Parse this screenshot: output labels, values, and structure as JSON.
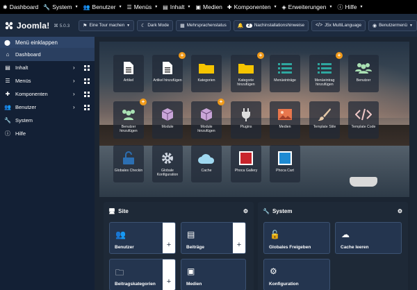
{
  "topmenu": {
    "items": [
      {
        "label": "Dashboard",
        "icon": "joomla-icon"
      },
      {
        "label": "System",
        "icon": "wrench-icon"
      },
      {
        "label": "Benutzer",
        "icon": "users-icon"
      },
      {
        "label": "Menüs",
        "icon": "list-icon"
      },
      {
        "label": "Inhalt",
        "icon": "file-icon"
      },
      {
        "label": "Medien",
        "icon": "image-icon"
      },
      {
        "label": "Komponenten",
        "icon": "puzzle-icon"
      },
      {
        "label": "Erweiterungen",
        "icon": "cube-icon"
      },
      {
        "label": "Hilfe",
        "icon": "info-icon"
      }
    ]
  },
  "header": {
    "brand": "Joomla!",
    "version": "⌘ 5.0.3",
    "buttons": [
      {
        "label": "Eine Tour machen",
        "icon": "signs-icon"
      },
      {
        "label": "Dark Mode",
        "icon": "moon-icon"
      },
      {
        "label": "Mehrsprachenstatus",
        "icon": "language-icon"
      },
      {
        "label": "Nachinstallationshinweise",
        "icon": "bell-icon",
        "badge": "2"
      },
      {
        "label": "J5x MultiLanguage",
        "icon": "code-icon"
      },
      {
        "label": "Benutzermenü",
        "icon": "user-icon"
      }
    ]
  },
  "sidebar": {
    "toggle_label": "Menü einklappen",
    "items": [
      {
        "label": "Dashboard",
        "icon": "home-icon"
      },
      {
        "label": "Inhalt",
        "icon": "file-icon"
      },
      {
        "label": "Menüs",
        "icon": "list-icon"
      },
      {
        "label": "Komponenten",
        "icon": "puzzle-icon"
      },
      {
        "label": "Benutzer",
        "icon": "users-icon"
      },
      {
        "label": "System",
        "icon": "wrench-icon"
      },
      {
        "label": "Hilfe",
        "icon": "info-icon"
      }
    ]
  },
  "hero": {
    "tiles": [
      {
        "label": "Artikel",
        "icon": "article-icon",
        "add": false
      },
      {
        "label": "Artikel hinzufügen",
        "icon": "article-icon",
        "add": true
      },
      {
        "label": "Kategorien",
        "icon": "folder-icon",
        "add": false
      },
      {
        "label": "Kategorie hinzufügen",
        "icon": "folder-icon",
        "add": true
      },
      {
        "label": "Menüeinträge",
        "icon": "menu-list-icon",
        "add": false
      },
      {
        "label": "Menüeintrag hinzufügen",
        "icon": "menu-list-icon",
        "add": true
      },
      {
        "label": "Benutzer",
        "icon": "users-icon",
        "add": false
      },
      {
        "label": "Benutzer hinzufügen",
        "icon": "users-icon",
        "add": true
      },
      {
        "label": "Module",
        "icon": "module-cube-icon",
        "add": false
      },
      {
        "label": "Module hinzufügen",
        "icon": "module-cube-icon",
        "add": true
      },
      {
        "label": "Plugins",
        "icon": "plug-icon",
        "add": false
      },
      {
        "label": "Medien",
        "icon": "image-icon",
        "add": false
      },
      {
        "label": "Template Stile",
        "icon": "brush-icon",
        "add": false
      },
      {
        "label": "Template Code",
        "icon": "code-icon",
        "add": false
      },
      {
        "label": "Globales Checkin",
        "icon": "unlock-icon",
        "add": false
      },
      {
        "label": "Globale Konfiguration",
        "icon": "gear-icon",
        "add": false
      },
      {
        "label": "Cache",
        "icon": "cloud-icon",
        "add": false
      },
      {
        "label": "Phoca Gallery",
        "icon": "pg-logo-icon",
        "add": false
      },
      {
        "label": "Phoca Cart",
        "icon": "pc-logo-icon",
        "add": false
      }
    ]
  },
  "panels": {
    "site": {
      "title": "Site",
      "cards": [
        {
          "label": "Benutzer",
          "icon": "users-icon",
          "add": true
        },
        {
          "label": "Beiträge",
          "icon": "file-icon",
          "add": true
        },
        {
          "label": "Beitragskategorien",
          "icon": "folder-open-icon",
          "add": true
        },
        {
          "label": "Medien",
          "icon": "image-icon",
          "add": false
        }
      ]
    },
    "system": {
      "title": "System",
      "cards": [
        {
          "label": "Globales Freigeben",
          "icon": "unlock-icon",
          "add": false
        },
        {
          "label": "Cache leeren",
          "icon": "cloud-icon",
          "add": false
        },
        {
          "label": "Konfiguration",
          "icon": "gear-icon",
          "add": false
        }
      ]
    }
  },
  "colors": {
    "topbar": "#000000",
    "header": "#1c2a3e",
    "sidebar": "#132035",
    "accent_orange": "#f09a1a",
    "folder_yellow": "#f5c400",
    "menu_teal": "#2fa7a0"
  }
}
